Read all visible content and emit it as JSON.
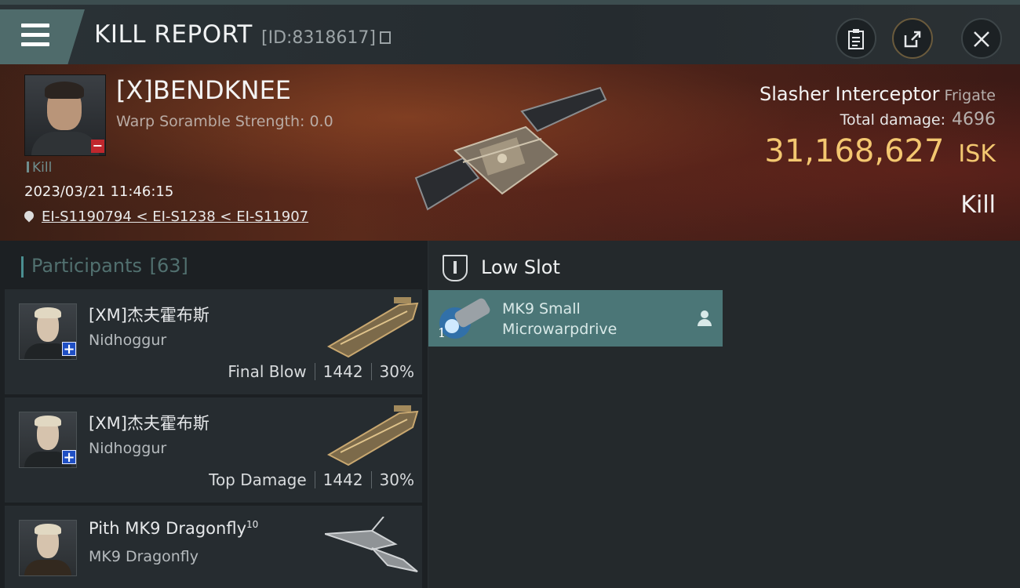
{
  "header": {
    "title": "KILL REPORT",
    "kill_id": "[ID:8318617]"
  },
  "victim": {
    "name": "[X]BENDKNEE",
    "warp_scramble": "Warp Soramble Strength: 0.0",
    "tag": "Kill",
    "datetime": "2023/03/21 11:46:15",
    "location": "EI-S1190794 < EI-S1238 < EI-S11907",
    "ship_name": "Slasher Interceptor",
    "ship_class": "Frigate",
    "total_damage_label": "Total damage:",
    "total_damage": "4696",
    "isk_value": "31,168,627",
    "isk_unit": "ISK",
    "result": "Kill"
  },
  "participants": {
    "label": "Participants",
    "count": "[63]",
    "rows": [
      {
        "name": "[XM]杰夫霍布斯",
        "ship": "Nidhoggur",
        "role": "Final Blow",
        "damage": "1442",
        "percent": "30%"
      },
      {
        "name": "[XM]杰夫霍布斯",
        "ship": "Nidhoggur",
        "role": "Top Damage",
        "damage": "1442",
        "percent": "30%"
      },
      {
        "name": "Pith MK9 Dragonfly",
        "level": "10",
        "ship": "MK9 Dragonfly"
      }
    ]
  },
  "slots": {
    "title": "Low Slot",
    "modules": [
      {
        "qty": "1",
        "name_line1": "MK9 Small",
        "name_line2": "Microwarpdrive"
      }
    ]
  },
  "icons": {
    "menu": "hamburger-icon",
    "copy": "copy-icon",
    "clipboard": "clipboard-icon",
    "share": "share-icon",
    "close": "close-icon",
    "location": "location-pin-icon",
    "slot": "low-slot-icon",
    "person": "person-icon"
  },
  "colors": {
    "accent": "#4b7677",
    "isk": "#f3c770",
    "negative_badge": "#c0272d",
    "positive_badge": "#1f4fc4"
  }
}
